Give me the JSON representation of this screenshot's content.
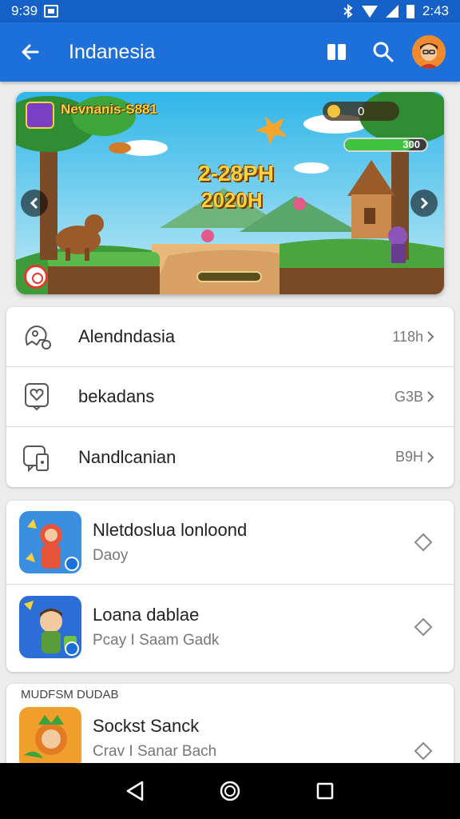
{
  "status_bar": {
    "time": "9:39",
    "right_time": "2:43"
  },
  "app_bar": {
    "title": "Indanesia"
  },
  "banner": {
    "game_title": "Nevnanis-S881",
    "coins": "0",
    "energy": "300",
    "energy_fraction": 0.82,
    "score_line1": "2-28PH",
    "score_line2": "2020H"
  },
  "menu": [
    {
      "label": "Alendndasia",
      "meta": "118h",
      "icon": "controller-icon"
    },
    {
      "label": "bekadans",
      "meta": "G3B",
      "icon": "heart-chat-icon"
    },
    {
      "label": "Nandlcanian",
      "meta": "B9H",
      "icon": "chat-tablet-icon"
    }
  ],
  "apps": [
    {
      "name": "Nletdoslua lonloond",
      "sub": "Daoy",
      "icon_color": "#e6553a",
      "bg_color": "#3a8fe0"
    },
    {
      "name": "Loana dablae",
      "sub": "Pcay I Saam Gadk",
      "icon_color": "#2f7de0",
      "bg_color": "#2b6fd6"
    }
  ],
  "section": {
    "header": "MUDFSM DUDAB",
    "app": {
      "name": "Sockst Sanck",
      "sub": "Crav I Sanar Bach",
      "icon_color": "#e27b24"
    }
  },
  "colors": {
    "primary": "#1d6fd9",
    "status": "#1561c7"
  }
}
